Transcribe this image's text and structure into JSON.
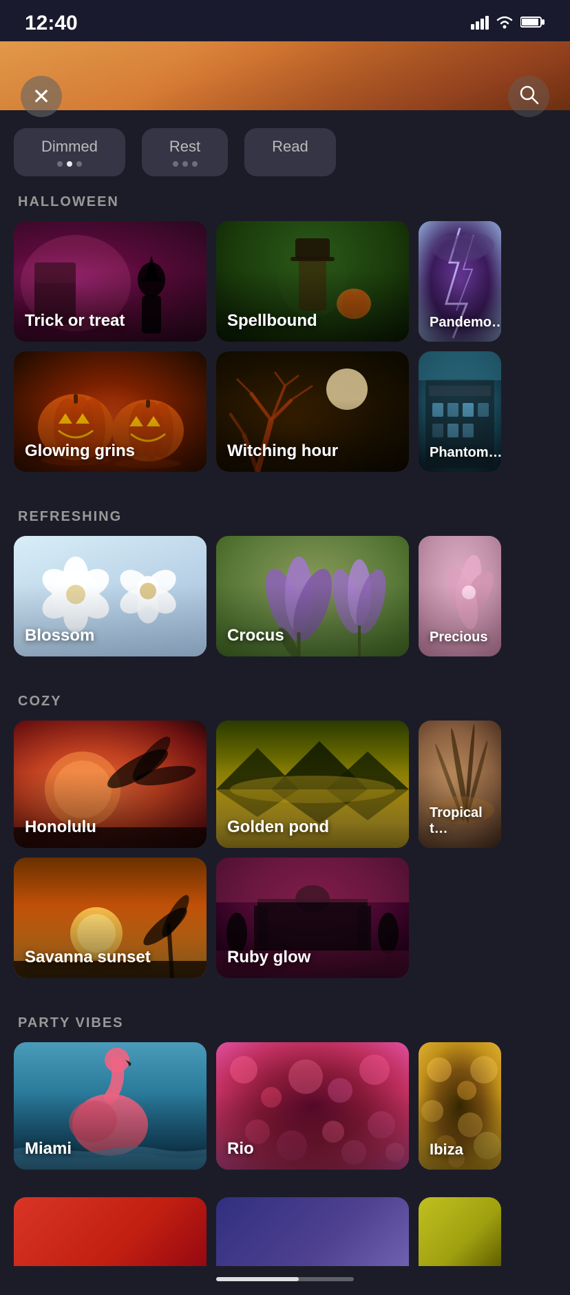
{
  "statusBar": {
    "time": "12:40",
    "signalIcon": "signal-bars",
    "wifiIcon": "wifi",
    "batteryIcon": "battery"
  },
  "header": {
    "closeLabel": "×",
    "searchIcon": "🔍"
  },
  "filterTabs": [
    {
      "label": "Dimmed",
      "dots": [
        false,
        true,
        false
      ]
    },
    {
      "label": "Rest",
      "dots": [
        false,
        false,
        false
      ]
    },
    {
      "label": "Read",
      "dots": []
    }
  ],
  "sections": [
    {
      "id": "halloween",
      "title": "HALLOWEEN",
      "rows": [
        [
          {
            "id": "trick-or-treat",
            "label": "Trick or treat",
            "style": "trick-card"
          },
          {
            "id": "spellbound",
            "label": "Spellbound",
            "style": "spellbound-card"
          },
          {
            "id": "pandemonium",
            "label": "Pandemo…",
            "style": "pandem-card",
            "partial": true
          }
        ],
        [
          {
            "id": "glowing-grins",
            "label": "Glowing grins",
            "style": "glowing-card"
          },
          {
            "id": "witching-hour",
            "label": "Witching hour",
            "style": "witching-card"
          },
          {
            "id": "phantom",
            "label": "Phantom…",
            "style": "phantom-card",
            "partial": true
          }
        ]
      ]
    },
    {
      "id": "refreshing",
      "title": "REFRESHING",
      "rows": [
        [
          {
            "id": "blossom",
            "label": "Blossom",
            "style": "blossom-card"
          },
          {
            "id": "crocus",
            "label": "Crocus",
            "style": "crocus-card"
          },
          {
            "id": "precious",
            "label": "Precious",
            "style": "precious-card",
            "partial": true
          }
        ]
      ]
    },
    {
      "id": "cozy",
      "title": "COZY",
      "rows": [
        [
          {
            "id": "honolulu",
            "label": "Honolulu",
            "style": "honolulu-card"
          },
          {
            "id": "golden-pond",
            "label": "Golden pond",
            "style": "golden-card"
          },
          {
            "id": "tropical",
            "label": "Tropical t…",
            "style": "tropical-card",
            "partial": true
          }
        ],
        [
          {
            "id": "savanna-sunset",
            "label": "Savanna sunset",
            "style": "savanna-card"
          },
          {
            "id": "ruby-glow",
            "label": "Ruby glow",
            "style": "ruby-card"
          }
        ]
      ]
    },
    {
      "id": "party-vibes",
      "title": "PARTY VIBES",
      "rows": [
        [
          {
            "id": "miami",
            "label": "Miami",
            "style": "miami-card"
          },
          {
            "id": "rio",
            "label": "Rio",
            "style": "rio-card"
          },
          {
            "id": "ibiza",
            "label": "Ibiza",
            "style": "ibiza-card",
            "partial": true
          }
        ]
      ]
    }
  ],
  "scrollProgress": 60
}
